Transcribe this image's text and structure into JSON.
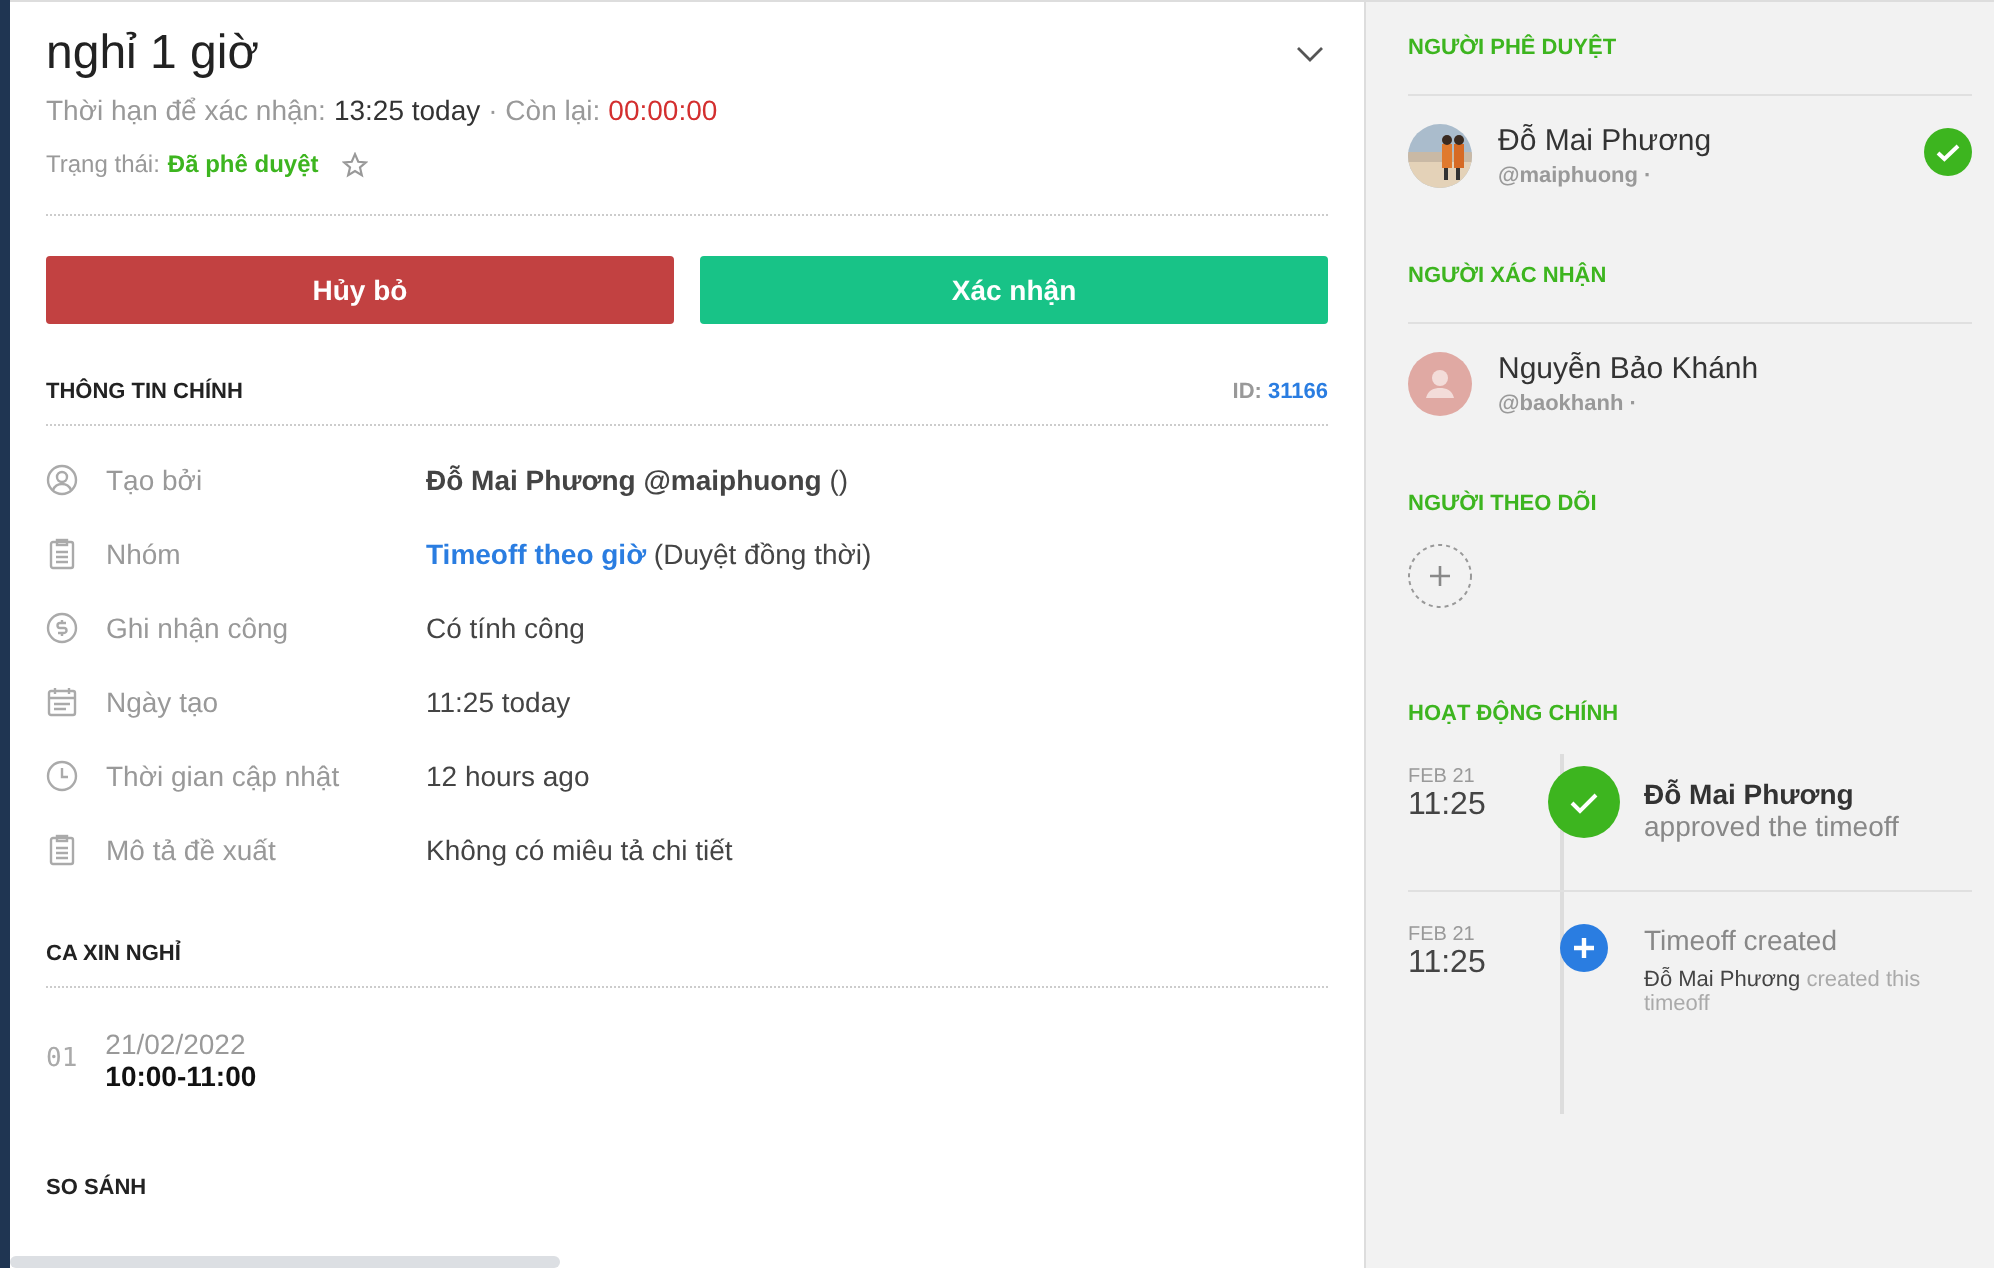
{
  "header": {
    "title": "nghỉ 1 giờ",
    "deadline_label": "Thời hạn để xác nhận:",
    "deadline_value": "13:25 today",
    "remaining_label": "· Còn lại:",
    "remaining_value": "00:00:00",
    "status_label": "Trạng thái:",
    "status_value": "Đã phê duyệt",
    "starred": false
  },
  "buttons": [
    {
      "label": "Hủy bỏ",
      "kind": "danger"
    },
    {
      "label": "Xác nhận",
      "kind": "confirm"
    }
  ],
  "main_info": {
    "heading": "THÔNG TIN CHÍNH",
    "id_label": "ID:",
    "id_value": "31166",
    "rows": [
      {
        "kind": "user",
        "label": "Tạo bởi",
        "value": "**Đỗ Mai Phương @maiphuong** ()"
      },
      {
        "kind": "clipboard",
        "label": "Nhóm",
        "link": "Timeoff theo giờ",
        "value": "(Duyệt đồng thời)"
      },
      {
        "kind": "coin",
        "label": "Ghi nhận công",
        "value": "Có tính công"
      },
      {
        "kind": "calendar",
        "label": "Ngày tạo",
        "value": "11:25 today"
      },
      {
        "kind": "clock",
        "label": "Thời gian cập nhật",
        "value": "12 hours ago"
      },
      {
        "kind": "clipboard",
        "label": "Mô tả đề xuất",
        "value": "Không có miêu tả chi tiết"
      }
    ]
  },
  "shifts": {
    "heading": "CA XIN NGHỈ",
    "items": [
      {
        "index": "01",
        "date": "21/02/2022",
        "time": "10:00-11:00"
      }
    ]
  },
  "next_heading": "SO SÁNH",
  "sidebar": {
    "approvers": {
      "heading": "NGƯỜI PHÊ DUYỆT",
      "people": [
        {
          "name": "Đỗ Mai Phương",
          "handle": "@maiphuong ·",
          "approved": true
        }
      ]
    },
    "confirmers": {
      "heading": "NGƯỜI XÁC NHẬN",
      "people": [
        {
          "name": "Nguyễn Bảo Khánh",
          "handle": "@baokhanh ·",
          "kind": "default",
          "approved": false
        }
      ]
    },
    "followers": {
      "heading": "NGƯỜI THEO DÕI"
    },
    "activity": {
      "heading": "HOẠT ĐỘNG CHÍNH",
      "items": [
        {
          "kind": "approved",
          "date": "FEB 21",
          "time": "11:25",
          "title": "Đỗ Mai Phương",
          "text": "approved the timeoff"
        },
        {
          "kind": "created",
          "date": "FEB 21",
          "time": "11:25",
          "title": "Timeoff created",
          "actor": "Đỗ Mai Phương",
          "text": "created this timeoff"
        }
      ]
    }
  }
}
